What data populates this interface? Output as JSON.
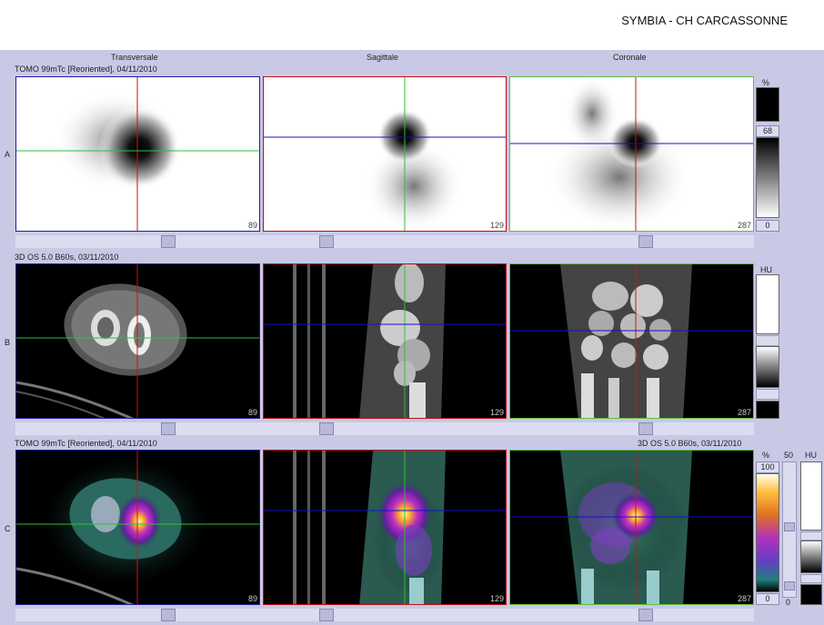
{
  "header": {
    "title": "SYMBIA - CH CARCASSONNE"
  },
  "columns": [
    "Transversale",
    "Sagittale",
    "Coronale"
  ],
  "rows": [
    {
      "label": "A",
      "series": "TOMO 99mTc [Reoriented], 04/11/2010"
    },
    {
      "label": "B",
      "series": "3D  OS  5.0  B60s, 03/11/2010"
    },
    {
      "label": "C",
      "series": "TOMO 99mTc [Reoriented], 04/11/2010",
      "series_right": "3D  OS  5.0  B60s, 03/11/2010"
    }
  ],
  "slices": {
    "transversale": "89",
    "sagittale": "129",
    "coronale": "287"
  },
  "colorbars": {
    "a": {
      "unit": "%",
      "top": "68",
      "bottom": "0"
    },
    "b": {
      "unit": "HU"
    },
    "c": {
      "unit": "%",
      "top": "100",
      "bottom": "0",
      "unit2": "50",
      "unit3": "HU",
      "slider_bottom": "0"
    }
  },
  "colors": {
    "background": "#c9c9e6",
    "crosshair_red": "#d01010",
    "crosshair_green": "#30c030",
    "crosshair_blue": "#1010d0",
    "frame_blue": "#2020a0",
    "frame_red": "#c01010",
    "frame_green": "#60c040"
  },
  "icons": [
    "slider-thumb",
    "colorbar-slider"
  ]
}
